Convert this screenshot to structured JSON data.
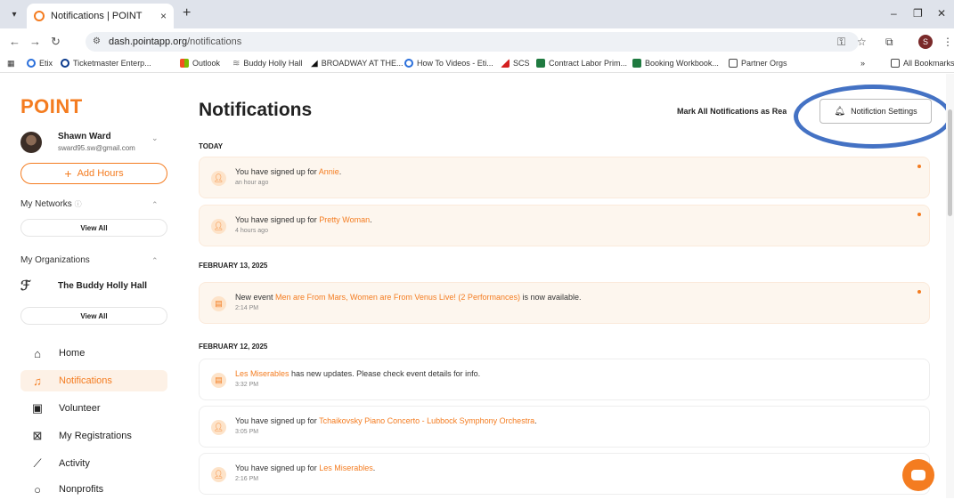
{
  "browser": {
    "tab_title": "Notifications | POINT",
    "tab_close": "×",
    "new_tab": "+",
    "url_domain": "dash.pointapp.org",
    "url_path": "/notifications",
    "profile_initial": "S",
    "bookmarks": [
      "Etix",
      "Ticketmaster Enterp...",
      "Outlook",
      "Buddy Holly Hall",
      "BROADWAY AT THE...",
      "How To Videos - Eti...",
      "SCS",
      "Contract Labor Prim...",
      "Booking Workbook...",
      "Partner Orgs"
    ],
    "bookmarks_overflow": "»",
    "all_bookmarks": "All Bookmarks"
  },
  "sidebar": {
    "logo": "POINT",
    "user_name": "Shawn Ward",
    "user_email": "sward95.sw@gmail.com",
    "add_hours": "Add Hours",
    "my_networks": "My Networks",
    "networks_view_all": "View All",
    "my_organizations": "My Organizations",
    "org_name": "The Buddy Holly Hall",
    "orgs_view_all": "View All",
    "nav": [
      {
        "label": "Home",
        "icon": "home-icon"
      },
      {
        "label": "Notifications",
        "icon": "bell-icon"
      },
      {
        "label": "Volunteer",
        "icon": "calendar-icon"
      },
      {
        "label": "My Registrations",
        "icon": "ticket-icon"
      },
      {
        "label": "Activity",
        "icon": "activity-icon"
      },
      {
        "label": "Nonprofits",
        "icon": "nonprofit-icon"
      }
    ]
  },
  "main": {
    "title": "Notifications",
    "mark_all": "Mark All Notifications as Read",
    "settings_button": "Notifiction Settings",
    "groups": [
      {
        "date": "TODAY",
        "items": [
          {
            "pre": "You have signed up for ",
            "link": "Annie",
            "post": ".",
            "time": "an hour ago",
            "unread": true
          },
          {
            "pre": "You have signed up for ",
            "link": "Pretty Woman",
            "post": ".",
            "time": "4 hours ago",
            "unread": true
          }
        ]
      },
      {
        "date": "FEBRUARY 13, 2025",
        "items": [
          {
            "pre": "New event ",
            "link": "Men are From Mars, Women are From Venus Live! (2 Performances)",
            "post": " is now available.",
            "time": "2:14 PM",
            "unread": true
          }
        ]
      },
      {
        "date": "FEBRUARY 12, 2025",
        "items": [
          {
            "pre": "",
            "link": "Les Miserables",
            "post": " has new updates. Please check event details for info.",
            "time": "3:32 PM",
            "unread": false
          },
          {
            "pre": "You have signed up for ",
            "link": "Tchaikovsky Piano Concerto - Lubbock Symphony Orchestra",
            "post": ".",
            "time": "3:05 PM",
            "unread": false
          },
          {
            "pre": "You have signed up for ",
            "link": "Les Miserables",
            "post": ".",
            "time": "2:16 PM",
            "unread": false
          }
        ]
      }
    ]
  },
  "colors": {
    "accent": "#f47c20",
    "highlight_circle": "#4472c4"
  }
}
